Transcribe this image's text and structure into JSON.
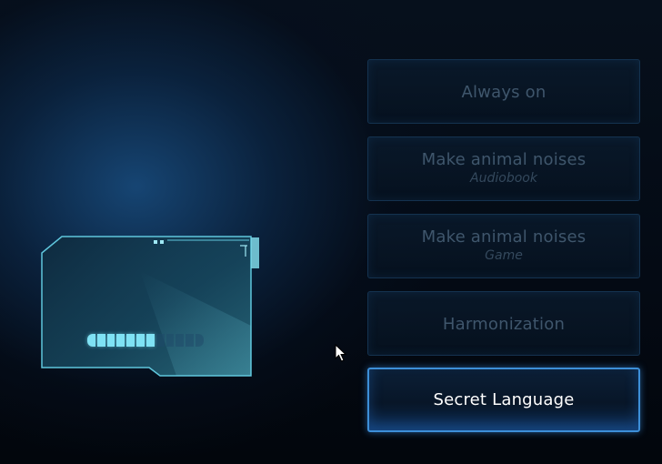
{
  "menu": {
    "items": [
      {
        "label": "Always on",
        "sublabel": "",
        "selected": false
      },
      {
        "label": "Make animal noises",
        "sublabel": "Audiobook",
        "selected": false
      },
      {
        "label": "Make animal noises",
        "sublabel": "Game",
        "selected": false
      },
      {
        "label": "Harmonization",
        "sublabel": "",
        "selected": false
      },
      {
        "label": "Secret Language",
        "sublabel": "",
        "selected": true
      }
    ]
  },
  "hologram": {
    "progress_segments_total": 12,
    "progress_segments_filled": 7
  },
  "colors": {
    "accent": "#3d8fd8",
    "panel_cyan": "#6fd3e6",
    "inactive_text": "#3f566c",
    "active_text": "#ffffff"
  }
}
